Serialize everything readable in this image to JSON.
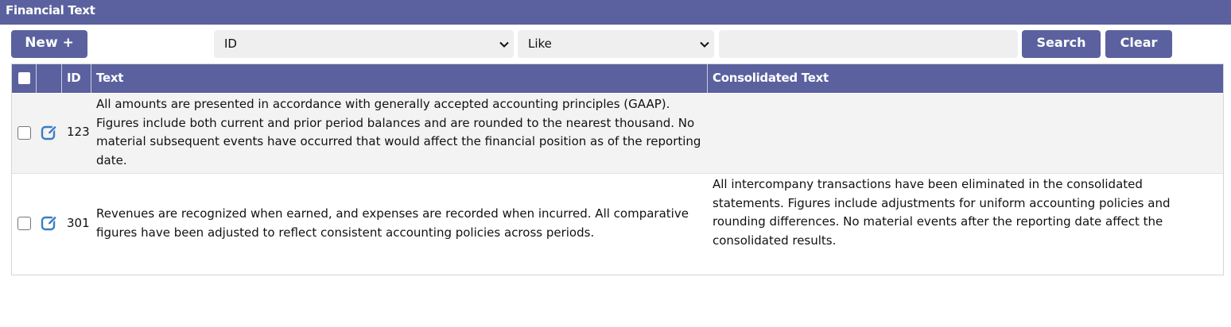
{
  "panel": {
    "title": "Financial Text"
  },
  "toolbar": {
    "new_label": "New +",
    "field_select": {
      "selected": "ID"
    },
    "operator_select": {
      "selected": "Like"
    },
    "search_input": {
      "value": ""
    },
    "search_label": "Search",
    "clear_label": "Clear"
  },
  "table": {
    "headers": {
      "id": "ID",
      "text": "Text",
      "consolidated": "Consolidated Text"
    },
    "rows": [
      {
        "id": "123",
        "text": "All amounts are presented in accordance with generally accepted accounting principles (GAAP). Figures include both current and prior period balances and are rounded to the nearest thousand. No material subsequent events have occurred that would affect the financial position as of the reporting date.",
        "consolidated": ""
      },
      {
        "id": "301",
        "text": "Revenues are recognized when earned, and expenses are recorded when incurred. All comparative figures have been adjusted to reflect consistent accounting policies across periods.",
        "consolidated": "All intercompany transactions have been eliminated in the consolidated statements. Figures include adjustments for uniform accounting policies and rounding differences. No material events after the reporting date affect the consolidated results."
      }
    ]
  },
  "colors": {
    "header": "#5a619e",
    "edit_icon": "#3b7cc4"
  }
}
